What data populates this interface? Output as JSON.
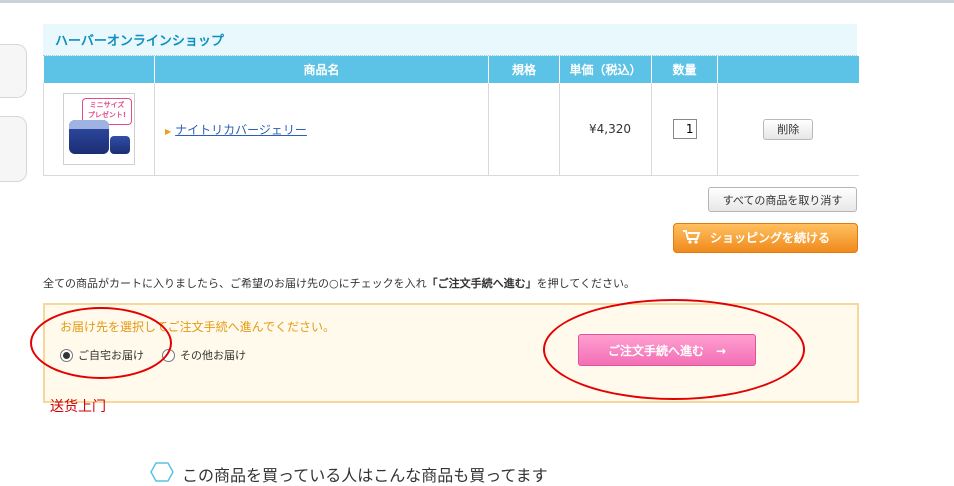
{
  "shop": {
    "title": "ハーバーオンラインショップ"
  },
  "table": {
    "headers": [
      "",
      "商品名",
      "規格",
      "単価（税込）",
      "数量",
      ""
    ],
    "row": {
      "badge": "ミニサイズ\nプレゼント!",
      "product_name": "ナイトリカバージェリー",
      "spec": "",
      "price": "¥4,320",
      "quantity": "1",
      "delete_label": "削除"
    }
  },
  "buttons": {
    "clear_all": "すべての商品を取り消す",
    "continue_shopping": "ショッピングを続ける",
    "proceed": "ご注文手続へ進む　→"
  },
  "instruction": {
    "pre": "全ての商品がカートに入りましたら、ご希望のお届け先の○にチェックを入れ",
    "bold": "「ご注文手続へ進む」",
    "post": "を押してください。"
  },
  "destination": {
    "title": "お届け先を選択してご注文手続へ進んでください。",
    "options": [
      {
        "label": "ご自宅お届け",
        "selected": true
      },
      {
        "label": "その他お届け",
        "selected": false
      }
    ]
  },
  "annotation": "送货上门",
  "related_title": "この商品を買っている人はこんな商品も買ってます",
  "colors": {
    "header_bg": "#5cc2e6",
    "accent_orange": "#f08a1c",
    "accent_pink": "#f26fb5",
    "annotation_red": "#e30000"
  }
}
